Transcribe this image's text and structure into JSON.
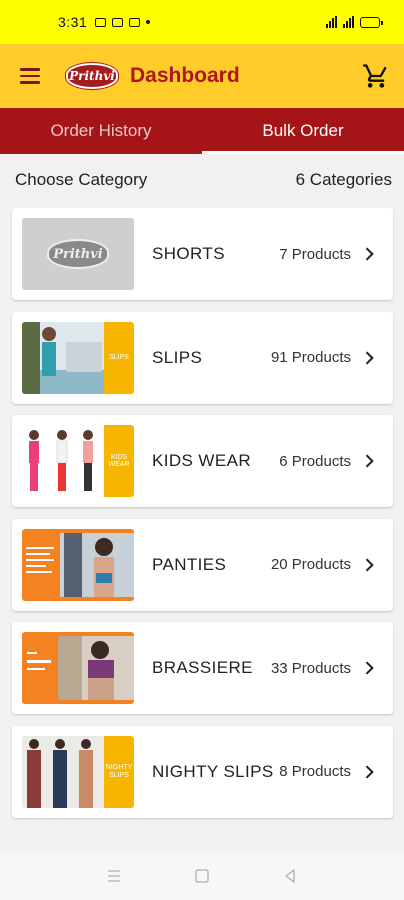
{
  "status_bar": {
    "time": "3:31"
  },
  "app_bar": {
    "logo_text": "Prithvi",
    "title": "Dashboard"
  },
  "tabs": [
    {
      "label": "Order History",
      "active": false
    },
    {
      "label": "Bulk Order",
      "active": true
    }
  ],
  "section": {
    "label": "Choose Category",
    "count": "6 Categories"
  },
  "categories": [
    {
      "name": "SHORTS",
      "count": "7 Products"
    },
    {
      "name": "SLIPS",
      "count": "91 Products",
      "banner_text": "SLIPS"
    },
    {
      "name": "KIDS WEAR",
      "count": "6 Products",
      "banner_text": "KIDS WEAR"
    },
    {
      "name": "PANTIES",
      "count": "20 Products"
    },
    {
      "name": "BRASSIERE",
      "count": "33 Products"
    },
    {
      "name": "NIGHTY SLIPS",
      "count": "8 Products",
      "banner_text": "NIGHTY SLIPS"
    }
  ],
  "colors": {
    "status_bar": "#ffff00",
    "app_bar": "#ffcc29",
    "tab_bar": "#a51417",
    "title": "#b3141c"
  }
}
